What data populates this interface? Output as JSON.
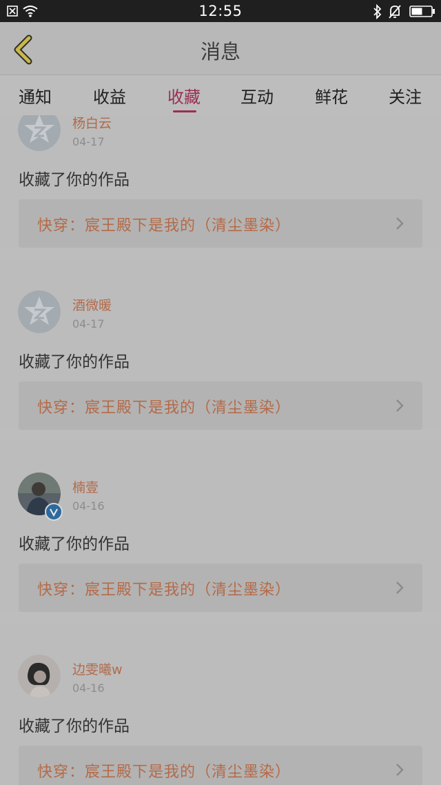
{
  "status_bar": {
    "time": "12:55"
  },
  "header": {
    "title": "消息"
  },
  "tabs": [
    {
      "label": "通知"
    },
    {
      "label": "收益"
    },
    {
      "label": "收藏"
    },
    {
      "label": "互动"
    },
    {
      "label": "鲜花"
    },
    {
      "label": "关注"
    }
  ],
  "active_tab": "收藏",
  "items": [
    {
      "username": "杨白云",
      "date": "04-17",
      "action": "收藏了你的作品",
      "work_title": "快穿：宸王殿下是我的（清尘墨染）",
      "avatar": "default-avatar-icon"
    },
    {
      "username": "酒微暖",
      "date": "04-17",
      "action": "收藏了你的作品",
      "work_title": "快穿：宸王殿下是我的（清尘墨染）",
      "avatar": "default-avatar-icon"
    },
    {
      "username": "楠壹",
      "date": "04-16",
      "action": "收藏了你的作品",
      "work_title": "快穿：宸王殿下是我的（清尘墨染）",
      "avatar": "user-photo",
      "verified": true
    },
    {
      "username": "边雯曦w",
      "date": "04-16",
      "action": "收藏了你的作品",
      "work_title": "快穿：宸王殿下是我的（清尘墨染）",
      "avatar": "user-photo"
    }
  ],
  "colors": {
    "accent": "#9a2e54",
    "username": "#b26a4a",
    "work_title": "#b46a48",
    "back_arrow": "#c9b84a"
  }
}
